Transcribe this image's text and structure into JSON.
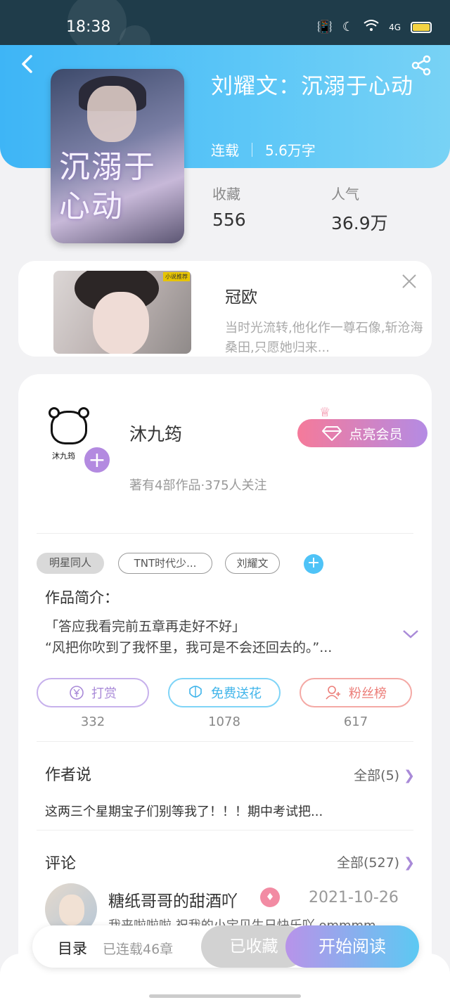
{
  "status_bar": {
    "time": "18:38",
    "network": "4G",
    "icons": [
      "vibrate-icon",
      "moon-icon",
      "wifi-icon",
      "signal-icon",
      "battery-icon"
    ]
  },
  "header": {
    "title": "刘耀文：沉溺于心动",
    "status": "连载",
    "word_count": "5.6万字",
    "cover_text": "沉溺于心动",
    "stats": [
      {
        "label": "收藏",
        "value": "556"
      },
      {
        "label": "人气",
        "value": "36.9万"
      }
    ]
  },
  "ad": {
    "title": "冠欧",
    "description": "当时光流转,他化作一尊石像,斩沧海桑田,只愿她归来..."
  },
  "author": {
    "name": "沐九筠",
    "meta": "著有4部作品·375人关注",
    "vip_button": "点亮会员"
  },
  "tags": [
    "明星同人",
    "TNT时代少...",
    "刘耀文"
  ],
  "intro": {
    "label": "作品简介：",
    "lines": [
      "「答应我看完前五章再走好不好」",
      "“风把你吹到了我怀里，我可是不会还回去的。”..."
    ]
  },
  "actions": [
    {
      "label": "打赏",
      "count": "332",
      "color": "#b893e9",
      "icon": "yen-icon"
    },
    {
      "label": "免费送花",
      "count": "1078",
      "color": "#4fc3f7",
      "icon": "flower-icon"
    },
    {
      "label": "粉丝榜",
      "count": "617",
      "color": "#f0847f",
      "icon": "fans-icon"
    }
  ],
  "author_says": {
    "title": "作者说",
    "more": "全部(5)",
    "text": "这两三个星期宝子们别等我了！！！期中考试把..."
  },
  "comments": {
    "title": "评论",
    "more": "全部(527)",
    "items": [
      {
        "user": "糖纸哥哥的甜酒吖",
        "date": "2021-10-26",
        "text": "我来啦啦啦 祝我的小宝贝生日快乐吖 ommmm"
      }
    ]
  },
  "bottom_bar": {
    "toc_label": "目录",
    "toc_status": "已连载46章",
    "collected_label": "已收藏",
    "read_label": "开始阅读"
  }
}
